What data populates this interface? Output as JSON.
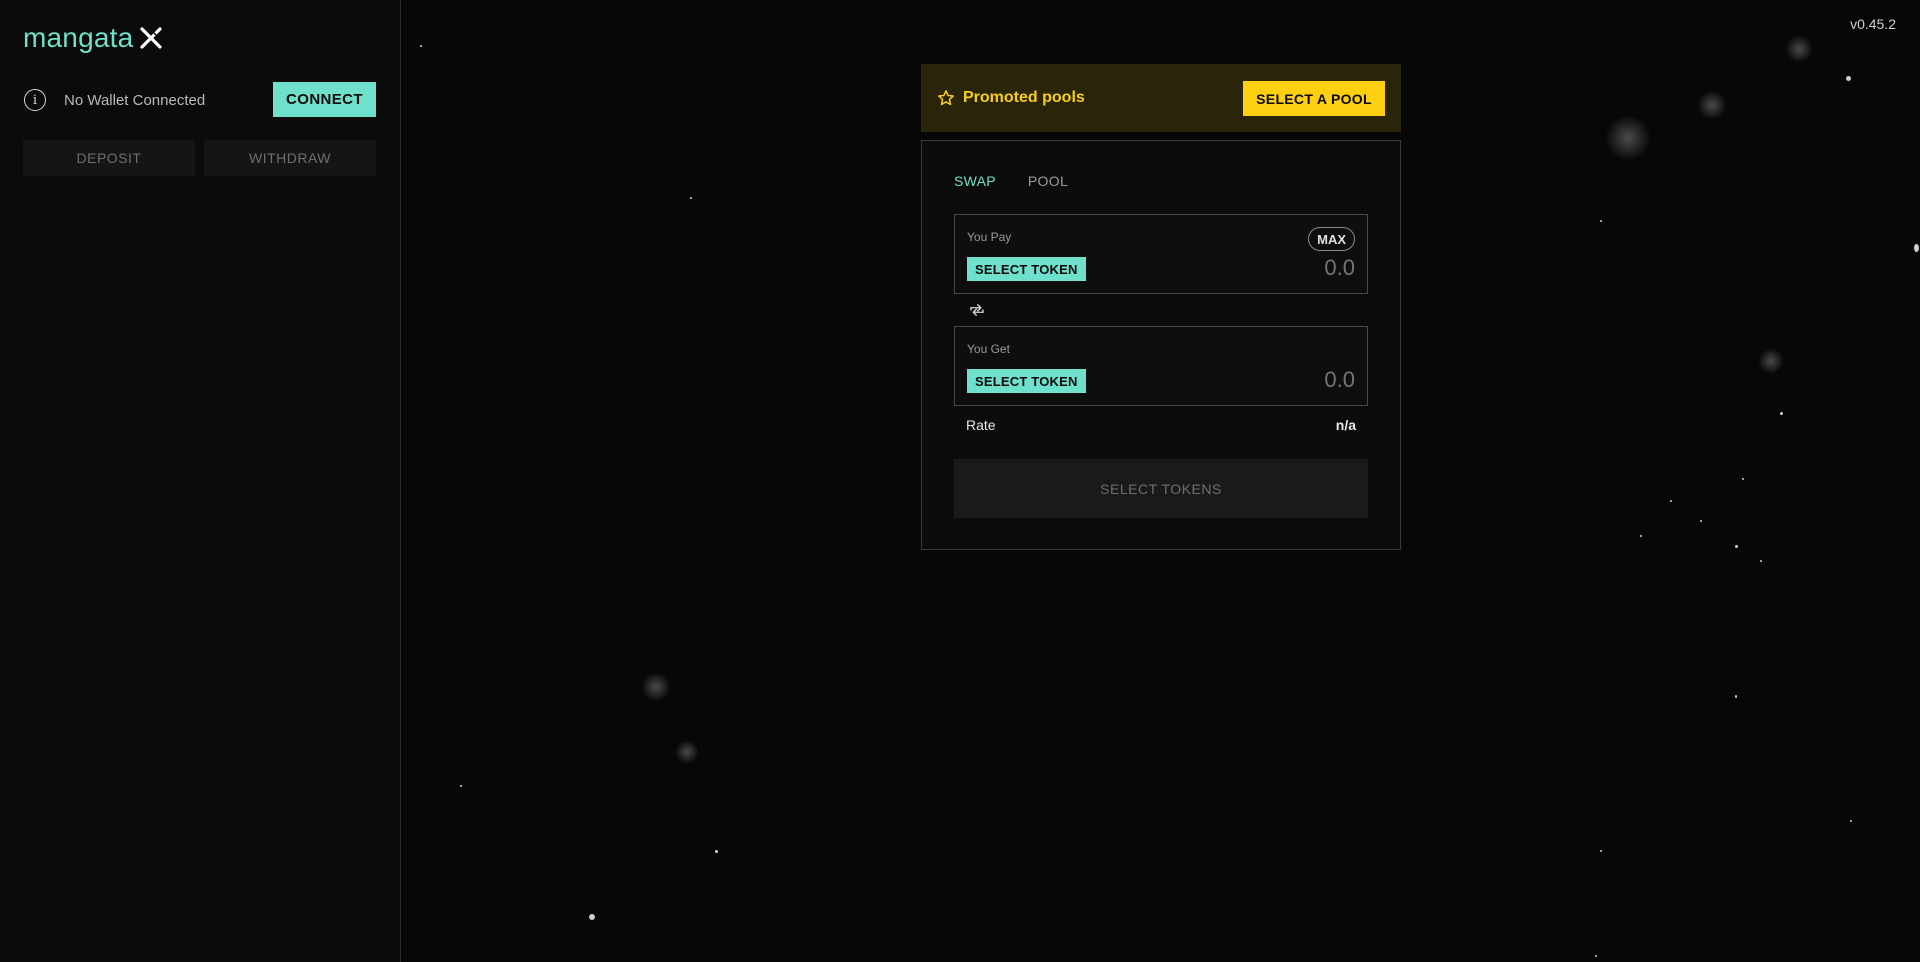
{
  "brand": {
    "name": "mangata",
    "accent": "#6fe0cc",
    "promo_color": "#ffd012"
  },
  "version": "v0.45.2",
  "sidebar": {
    "wallet_status": "No Wallet Connected",
    "connect_label": "CONNECT",
    "deposit_label": "DEPOSIT",
    "withdraw_label": "WITHDRAW"
  },
  "promo": {
    "label": "Promoted pools",
    "button_label": "SELECT A POOL"
  },
  "swap": {
    "tabs": [
      {
        "label": "SWAP",
        "active": true
      },
      {
        "label": "POOL",
        "active": false
      }
    ],
    "pay": {
      "label": "You Pay",
      "select_label": "SELECT TOKEN",
      "amount": "0.0",
      "max_label": "MAX"
    },
    "get": {
      "label": "You Get",
      "select_label": "SELECT TOKEN",
      "amount": "0.0"
    },
    "rate_label": "Rate",
    "rate_value": "n/a",
    "submit_label": "SELECT TOKENS"
  }
}
